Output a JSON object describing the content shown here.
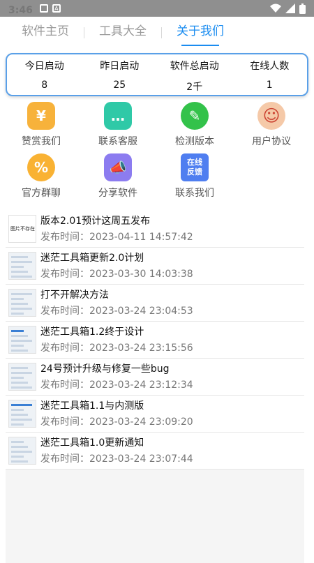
{
  "status": {
    "time": "3:46"
  },
  "tabs": [
    {
      "label": "软件主页",
      "active": false
    },
    {
      "label": "工具大全",
      "active": false
    },
    {
      "label": "关于我们",
      "active": true
    }
  ],
  "stats": [
    {
      "label": "今日启动",
      "value": "8"
    },
    {
      "label": "昨日启动",
      "value": "25"
    },
    {
      "label": "软件总启动",
      "value": "2千"
    },
    {
      "label": "在线人数",
      "value": "1"
    }
  ],
  "grid": [
    {
      "label": "赞赏我们",
      "icon": "yuan-icon",
      "color": "#f7b23b",
      "glyph": "¥"
    },
    {
      "label": "联系客服",
      "icon": "chat-icon",
      "color": "#2fc9a7",
      "glyph": "…"
    },
    {
      "label": "检测版本",
      "icon": "pencil-icon",
      "color": "#33c24a",
      "glyph": "✎"
    },
    {
      "label": "用户协议",
      "icon": "user-avatar-icon",
      "color": "#ef6c6c",
      "glyph": "☺"
    },
    {
      "label": "官方群聊",
      "icon": "percent-icon",
      "color": "#f9b233",
      "glyph": "%"
    },
    {
      "label": "分享软件",
      "icon": "megaphone-icon",
      "color": "#8c7cf0",
      "glyph": "📣"
    },
    {
      "label": "联系我们",
      "icon": "feedback-icon",
      "color": "#4f7ef0",
      "glyph": "在线\n反馈"
    }
  ],
  "thumb_blank_text": "图片不存在",
  "news": [
    {
      "title": "版本2.01预计这周五发布",
      "time": "发布时间：2023-04-11 14:57:42"
    },
    {
      "title": "迷茫工具箱更新2.0计划",
      "time": "发布时间：2023-03-30 14:03:38"
    },
    {
      "title": "打不开解决方法",
      "time": "发布时间：2023-03-24 23:04:53"
    },
    {
      "title": "迷茫工具箱1.2终于设计",
      "time": "发布时间：2023-03-24 23:15:56"
    },
    {
      "title": "24号预计升级与修复一些bug",
      "time": "发布时间：2023-03-24 23:12:34"
    },
    {
      "title": "迷茫工具箱1.1与内测版",
      "time": "发布时间：2023-03-24 23:09:20"
    },
    {
      "title": "迷茫工具箱1.0更新通知",
      "time": "发布时间：2023-03-24 23:07:44"
    }
  ]
}
